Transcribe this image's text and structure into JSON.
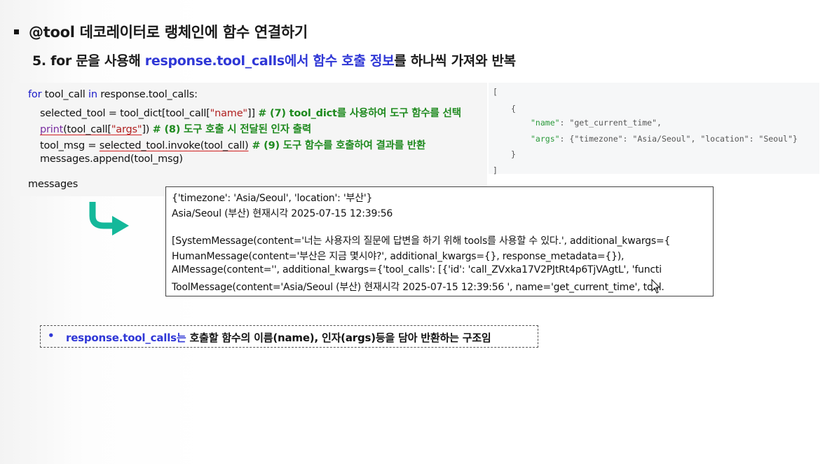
{
  "heading": {
    "bullet_title": "@tool 데코레이터로 랭체인에 함수 연결하기",
    "step_prefix": "5. for 문을 사용해 ",
    "step_highlight_1": "response.tool_calls에서 함수 호출 정보",
    "step_suffix": "를 하나씩 가져와 반복"
  },
  "code": {
    "line1_kw1": "for",
    "line1_mid": " tool_call ",
    "line1_kw2": "in",
    "line1_end": " response.tool_calls:",
    "line2_pre": "selected_tool = tool_dict[tool_call[",
    "line2_str": "\"name\"",
    "line2_post": "]] ",
    "line2_comment": "# (7) tool_dict를 사용하여 도구 함수를 선택",
    "line3_fn": "print",
    "line3_mid": "(tool_call[",
    "line3_str": "\"args\"",
    "line3_post": "]) ",
    "line3_comment": "# (8) 도구 호출 시 전달된 인자 출력",
    "line4_pre": "tool_msg = ",
    "line4_ul": "selected_tool.invoke(tool_call)",
    "line4_comment": " # (9) 도구 함수를 호출하여 결과를 반환",
    "line5": "messages.append(tool_msg)",
    "line6": "messages"
  },
  "json_sample": {
    "open_bracket": "[",
    "open_brace": "{",
    "name_key": "\"name\"",
    "name_val": ": \"get_current_time\",",
    "args_key": "\"args\"",
    "args_val": ": {\"timezone\": \"Asia/Seoul\", \"location\": \"Seoul\"}",
    "close_brace": "}",
    "close_bracket": "]"
  },
  "output": {
    "line1": "{'timezone': 'Asia/Seoul', 'location': '부산'}",
    "line2": "Asia/Seoul (부산) 현재시각 2025-07-15 12:39:56",
    "line3": "[SystemMessage(content='너는 사용자의 질문에 답변을 하기 위해 tools를 사용할 수 있다.', additional_kwargs={",
    "line4": " HumanMessage(content='부산은 지금 몇시야?', additional_kwargs={}, response_metadata={}),",
    "line5": " AIMessage(content='', additional_kwargs={'tool_calls': [{'id': 'call_ZVxka17V2PJtRt4p6TjVAgtL', 'functi",
    "line6": " ToolMessage(content='Asia/Seoul (부산) 현재시각 2025-07-15 12:39:56 ', name='get_current_time', tool."
  },
  "note": {
    "bullet": "•",
    "highlight": "response.tool_calls는",
    "text": " 호출할 함수의 이름(name), 인자(args)등을 담아 반환하는 구조임"
  },
  "colors": {
    "accent_blue": "#2f37d6",
    "arrow_teal": "#14b89a",
    "comment_green": "#1f8a1f",
    "string_red": "#b02020"
  },
  "icons": {
    "arrow": "curved-arrow-icon",
    "cursor": "mouse-cursor-icon"
  }
}
